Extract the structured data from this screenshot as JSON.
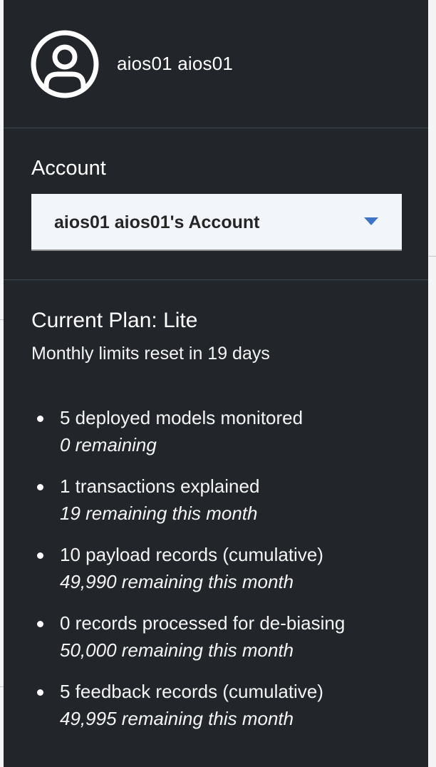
{
  "user": {
    "name": "aios01 aios01"
  },
  "account": {
    "label": "Account",
    "selected": "aios01 aios01's Account"
  },
  "plan": {
    "title": "Current Plan: Lite",
    "reset_text": "Monthly limits reset in 19 days",
    "limits": [
      {
        "main": "5 deployed models monitored",
        "sub": "0 remaining"
      },
      {
        "main": "1 transactions explained",
        "sub": "19 remaining this month"
      },
      {
        "main": "10 payload records (cumulative)",
        "sub": "49,990 remaining this month"
      },
      {
        "main": "0 records processed for de-biasing",
        "sub": "50,000 remaining this month"
      },
      {
        "main": "5 feedback records (cumulative)",
        "sub": "49,995 remaining this month"
      }
    ]
  },
  "colors": {
    "panel_bg": "#22262b",
    "select_bg": "#f2f5fa",
    "chevron": "#3f73c7"
  },
  "icons": {
    "avatar": "user-avatar-icon",
    "dropdown": "chevron-down-icon"
  }
}
